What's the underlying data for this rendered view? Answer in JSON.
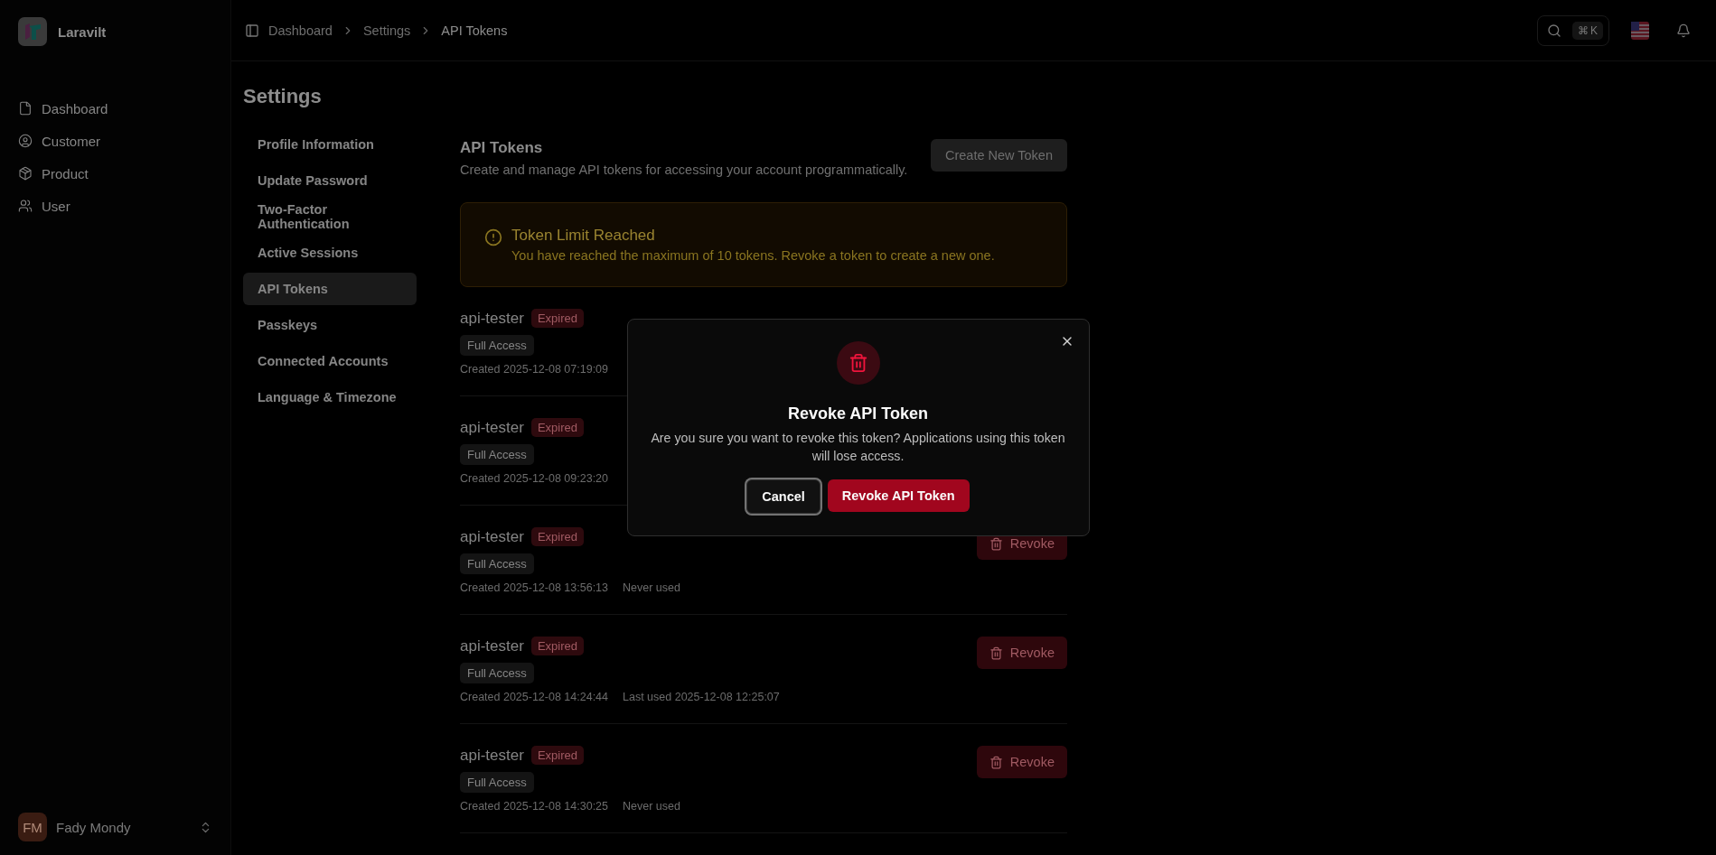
{
  "sidebar": {
    "brand": "Laravilt",
    "nav": [
      {
        "label": "Dashboard"
      },
      {
        "label": "Customer"
      },
      {
        "label": "Product"
      },
      {
        "label": "User"
      }
    ],
    "user": {
      "initials": "FM",
      "name": "Fady Mondy"
    }
  },
  "breadcrumbs": [
    "Dashboard",
    "Settings",
    "API Tokens"
  ],
  "header": {
    "shortcut_symbol": "⌘",
    "shortcut_key": "K"
  },
  "page_title": "Settings",
  "settings_nav": [
    {
      "label": "Profile Information",
      "selected": false
    },
    {
      "label": "Update Password",
      "selected": false
    },
    {
      "label": "Two-Factor Authentication",
      "selected": false
    },
    {
      "label": "Active Sessions",
      "selected": false
    },
    {
      "label": "API Tokens",
      "selected": true
    },
    {
      "label": "Passkeys",
      "selected": false
    },
    {
      "label": "Connected Accounts",
      "selected": false
    },
    {
      "label": "Language & Timezone",
      "selected": false
    }
  ],
  "section": {
    "title": "API Tokens",
    "description": "Create and manage API tokens for accessing your account programmatically.",
    "create_button": {
      "label": "Create New Token",
      "disabled": true
    }
  },
  "alert": {
    "title": "Token Limit Reached",
    "message": "You have reached the maximum of 10 tokens. Revoke a token to create a new one."
  },
  "tokens": [
    {
      "name": "api-tester",
      "status": "Expired",
      "scope": "Full Access",
      "created": "Created 2025-12-08 07:19:09"
    },
    {
      "name": "api-tester",
      "status": "Expired",
      "scope": "Full Access",
      "created": "Created 2025-12-08 09:23:20"
    },
    {
      "name": "api-tester",
      "status": "Expired",
      "scope": "Full Access",
      "created": "Created 2025-12-08 13:56:13",
      "last_used": "Never used",
      "revoke": "Revoke"
    },
    {
      "name": "api-tester",
      "status": "Expired",
      "scope": "Full Access",
      "created": "Created 2025-12-08 14:24:44",
      "last_used": "Last used 2025-12-08 12:25:07",
      "revoke": "Revoke"
    },
    {
      "name": "api-tester",
      "status": "Expired",
      "scope": "Full Access",
      "created": "Created 2025-12-08 14:30:25",
      "last_used": "Never used",
      "revoke": "Revoke"
    }
  ],
  "dialog": {
    "title": "Revoke API Token",
    "message": "Are you sure you want to revoke this token? Applications using this token will lose access.",
    "cancel": {
      "label": "Cancel",
      "focused": true
    },
    "confirm": "Revoke API Token"
  }
}
